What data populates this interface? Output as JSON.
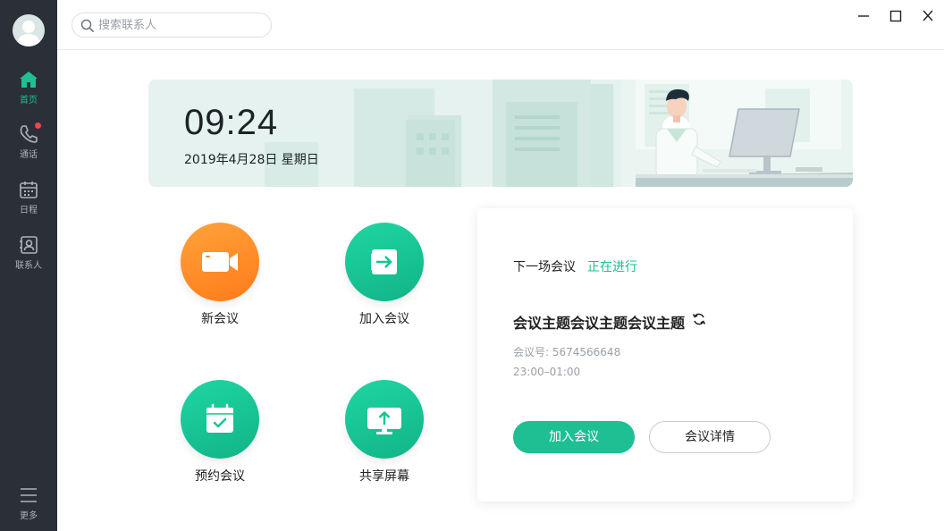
{
  "sidebar": {
    "items": [
      {
        "label": "首页",
        "icon": "home-icon",
        "active": true
      },
      {
        "label": "通话",
        "icon": "phone-icon",
        "has_notification": true
      },
      {
        "label": "日程",
        "icon": "calendar-icon"
      },
      {
        "label": "联系人",
        "icon": "contacts-icon"
      }
    ],
    "more_label": "更多",
    "more_icon": "menu-icon"
  },
  "search": {
    "placeholder": "搜索联系人",
    "icon": "search-icon"
  },
  "window_controls": [
    "minimize-icon",
    "maximize-icon",
    "close-icon"
  ],
  "banner": {
    "time": "09:24",
    "date": "2019年4月28日  星期日"
  },
  "actions": [
    {
      "label": "新会议",
      "icon": "video-camera-icon",
      "color": "#ff8a24"
    },
    {
      "label": "加入会议",
      "icon": "enter-icon",
      "color": "#17c496"
    },
    {
      "label": "预约会议",
      "icon": "calendar-check-icon",
      "color": "#17c496"
    },
    {
      "label": "共享屏幕",
      "icon": "screen-share-icon",
      "color": "#17c496"
    }
  ],
  "meeting_card": {
    "header_label": "下一场会议",
    "status": "正在进行",
    "topic": "会议主题会议主题会议主题",
    "meeting_id": "会议号: 5674566648",
    "time_range": "23:00–01:00",
    "join_button": "加入会议",
    "details_button": "会议详情"
  },
  "colors": {
    "accent": "#1dbf93",
    "sidebar_bg": "#2b2f37",
    "orange": "#ff8a24",
    "notification": "#f04747"
  }
}
